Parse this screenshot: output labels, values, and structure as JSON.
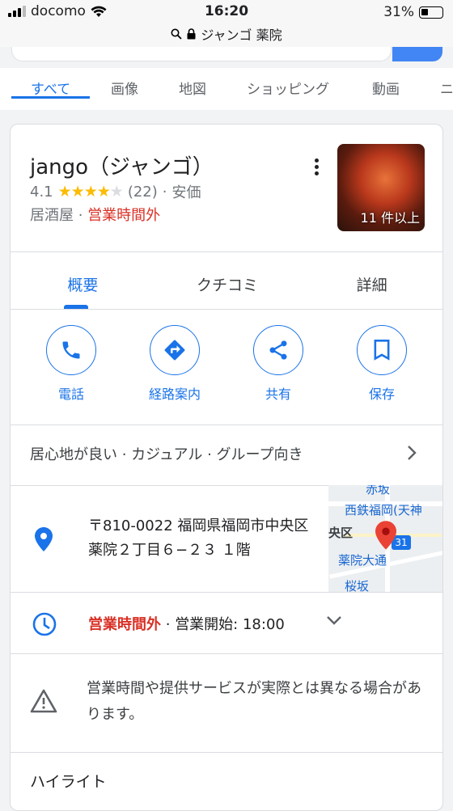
{
  "status_bar": {
    "carrier": "docomo",
    "time": "16:20",
    "battery": "31%",
    "url": "ジャンゴ 薬院"
  },
  "tabs": [
    "すべて",
    "画像",
    "地図",
    "ショッピング",
    "動画",
    "ニ"
  ],
  "business": {
    "name": "jango（ジャンゴ）",
    "rating": "4.1",
    "stars_value": 4.1,
    "review_count": "(22)",
    "price": "安価",
    "category": "居酒屋",
    "status": "営業時間外",
    "photo_count": "11 件以上"
  },
  "subtabs": [
    "概要",
    "クチコミ",
    "詳細"
  ],
  "actions": [
    {
      "label": "電話",
      "icon": "phone-icon"
    },
    {
      "label": "経路案内",
      "icon": "directions-icon"
    },
    {
      "label": "共有",
      "icon": "share-icon"
    },
    {
      "label": "保存",
      "icon": "bookmark-icon"
    }
  ],
  "tags": "居心地が良い · カジュアル · グループ向き",
  "address": "〒810-0022 福岡県福岡市中央区薬院２丁目６−２３ １階",
  "map_labels": {
    "top": "赤坂",
    "line1": "西鉄福岡(天神",
    "district": "央区",
    "station": "薬院大通",
    "route": "31",
    "bottom": "桜坂"
  },
  "hours": {
    "status": "営業時間外",
    "open_text": "営業開始: 18:00"
  },
  "warning": "営業時間や提供サービスが実際とは異なる場合があります。",
  "highlights_title": "ハイライト",
  "colors": {
    "accent": "#1a73e8",
    "closed": "#d93025",
    "star": "#fbbc04"
  }
}
